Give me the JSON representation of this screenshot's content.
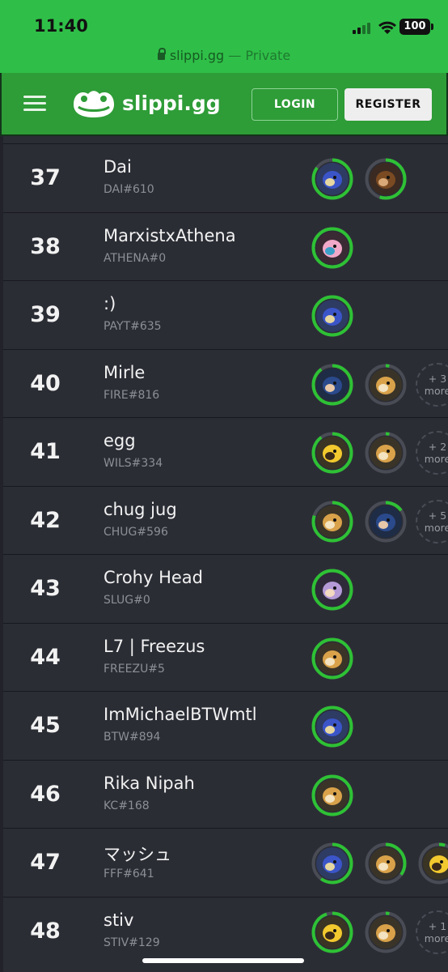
{
  "status": {
    "time": "11:40",
    "battery": "100"
  },
  "browser": {
    "domain": "slippi.gg",
    "private_label": "— Private"
  },
  "nav": {
    "logo_text": "slippi.gg",
    "login_label": "LOGIN",
    "register_label": "REGISTER"
  },
  "colors": {
    "ring_green": "#2ec135",
    "ring_track": "#4a4c55",
    "brand_green": "#2e9c37"
  },
  "players": [
    {
      "rank": "37",
      "name": "Dai",
      "code": "DAI#610",
      "chars": [
        {
          "icon": "falco-icon",
          "usage": 0.85
        },
        {
          "icon": "donkey-kong-icon",
          "usage": 0.55
        }
      ],
      "more": ""
    },
    {
      "rank": "38",
      "name": "MarxistxAthena",
      "code": "ATHENA#0",
      "chars": [
        {
          "icon": "jigglypuff-icon",
          "usage": 1.0
        }
      ],
      "more": ""
    },
    {
      "rank": "39",
      "name": ":)",
      "code": "PAYT#635",
      "chars": [
        {
          "icon": "falco-icon",
          "usage": 1.0
        }
      ],
      "more": ""
    },
    {
      "rank": "40",
      "name": "Mirle",
      "code": "FIRE#816",
      "chars": [
        {
          "icon": "marth-icon",
          "usage": 0.9
        },
        {
          "icon": "fox-icon",
          "usage": 0.03
        }
      ],
      "more": "+ 3 more"
    },
    {
      "rank": "41",
      "name": "egg",
      "code": "WILS#334",
      "chars": [
        {
          "icon": "pikachu-icon",
          "usage": 0.9
        },
        {
          "icon": "fox-icon",
          "usage": 0.03
        }
      ],
      "more": "+ 2 more"
    },
    {
      "rank": "42",
      "name": "chug jug",
      "code": "CHUG#596",
      "chars": [
        {
          "icon": "fox-icon",
          "usage": 0.8
        },
        {
          "icon": "marth-icon",
          "usage": 0.15
        }
      ],
      "more": "+ 5 more"
    },
    {
      "rank": "43",
      "name": "Crohy Head",
      "code": "SLUG#0",
      "chars": [
        {
          "icon": "ice-climbers-icon",
          "usage": 1.0
        }
      ],
      "more": ""
    },
    {
      "rank": "44",
      "name": "L7 | Freezus",
      "code": "FREEZU#5",
      "chars": [
        {
          "icon": "fox-icon",
          "usage": 1.0
        }
      ],
      "more": ""
    },
    {
      "rank": "45",
      "name": "ImMichaelBTWmtl",
      "code": "BTW#894",
      "chars": [
        {
          "icon": "falco-icon",
          "usage": 1.0
        }
      ],
      "more": ""
    },
    {
      "rank": "46",
      "name": "Rika Nipah",
      "code": "KC#168",
      "chars": [
        {
          "icon": "fox-icon",
          "usage": 1.0
        }
      ],
      "more": ""
    },
    {
      "rank": "47",
      "name": "マッシュ",
      "code": "FFF#641",
      "chars": [
        {
          "icon": "falco-icon",
          "usage": 0.6
        },
        {
          "icon": "fox-icon",
          "usage": 0.35
        },
        {
          "icon": "pikachu-icon",
          "usage": 0.05
        }
      ],
      "more": ""
    },
    {
      "rank": "48",
      "name": "stiv",
      "code": "STIV#129",
      "chars": [
        {
          "icon": "pikachu-icon",
          "usage": 0.95
        },
        {
          "icon": "fox-icon",
          "usage": 0.03
        }
      ],
      "more": "+ 1 more"
    }
  ]
}
